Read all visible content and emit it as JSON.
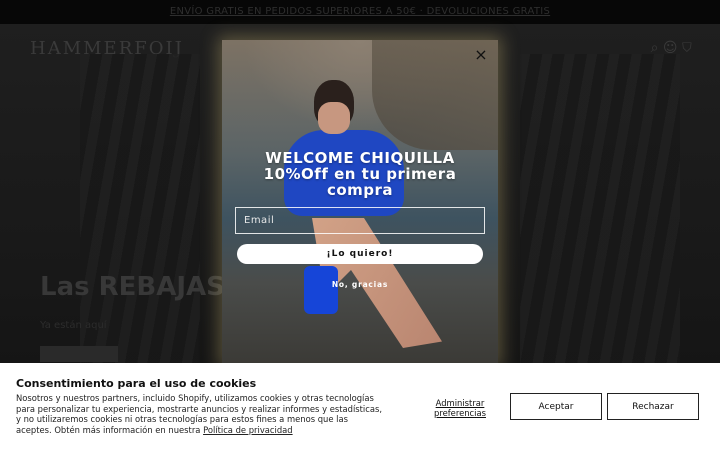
{
  "announcement": {
    "text": "ENVÍO GRATIS EN PEDIDOS SUPERIORES A 50€ · DEVOLUCIONES GRATIS"
  },
  "site": {
    "logo": "HAMMERFOIJ",
    "hero_title": "Las REBAJAS",
    "hero_subtitle": "Ya están aquí"
  },
  "popup": {
    "title_line1": "WELCOME CHIQUILLA",
    "title_line2": "10%Off en tu primera",
    "title_line3": "compra",
    "email_placeholder": "Email",
    "cta_label": "¡Lo quiero!",
    "decline_label": "No, gracias",
    "close_icon": "×"
  },
  "cookies": {
    "title": "Consentimiento para el uso de cookies",
    "body": "Nosotros y nuestros partners, incluido Shopify, utilizamos cookies y otras tecnologías para personalizar tu experiencia, mostrarte anuncios y realizar informes y estadísticas, y no utilizaremos cookies ni otras tecnologías para estos fines a menos que las aceptes. Obtén más información en nuestra ",
    "privacy_link": "Política de privacidad",
    "manage_label": "Administrar preferencias",
    "accept_label": "Aceptar",
    "reject_label": "Rechazar"
  }
}
